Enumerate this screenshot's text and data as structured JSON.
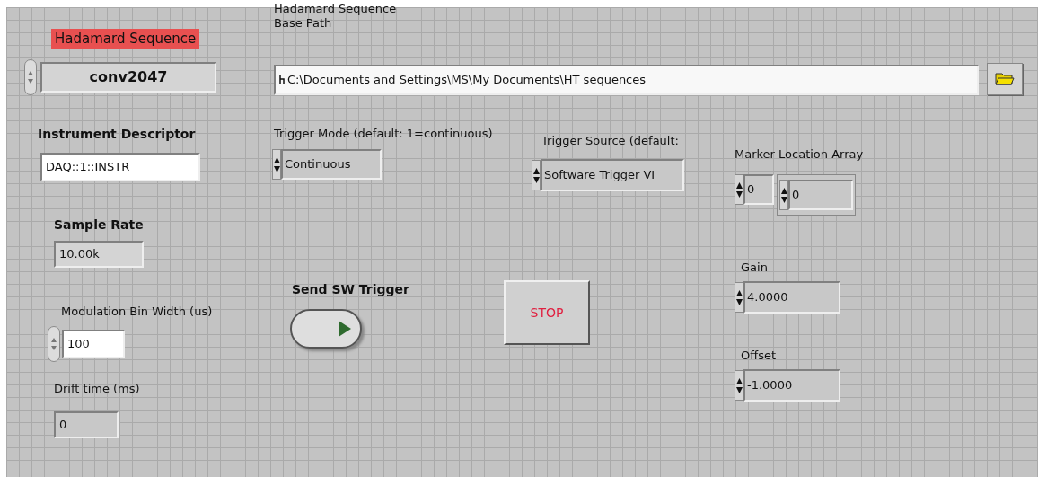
{
  "sequence_ring": {
    "label": "Hadamard Sequence",
    "highlighted": true,
    "value": "conv2047"
  },
  "instrument_descriptor": {
    "label": "Instrument Descriptor",
    "value": "DAQ::1::INSTR"
  },
  "sample_rate": {
    "label": "Sample Rate",
    "value": "10.00k"
  },
  "modulation_bin_width": {
    "label": "Modulation Bin Width (us)",
    "value": "100"
  },
  "drift_time": {
    "label": "Drift time (ms)",
    "value": "0"
  },
  "base_path": {
    "label_lines": [
      "Hadamard Sequence",
      "Base Path"
    ],
    "value": "C:\\Documents and Settings\\MS\\My Documents\\HT sequences"
  },
  "trigger_mode": {
    "label": "Trigger Mode (default: 1=continuous)",
    "value": "Continuous"
  },
  "trigger_source": {
    "label": "Trigger Source (default:",
    "value": "Software Trigger VI"
  },
  "marker_location_array": {
    "label": "Marker Location Array",
    "index": "0",
    "element": "0"
  },
  "send_sw_trigger": {
    "label": "Send SW Trigger",
    "on": false
  },
  "stop_button": {
    "label": "STOP"
  },
  "gain": {
    "label": "Gain",
    "value": "4.0000"
  },
  "offset": {
    "label": "Offset",
    "value": "-1.0000"
  }
}
